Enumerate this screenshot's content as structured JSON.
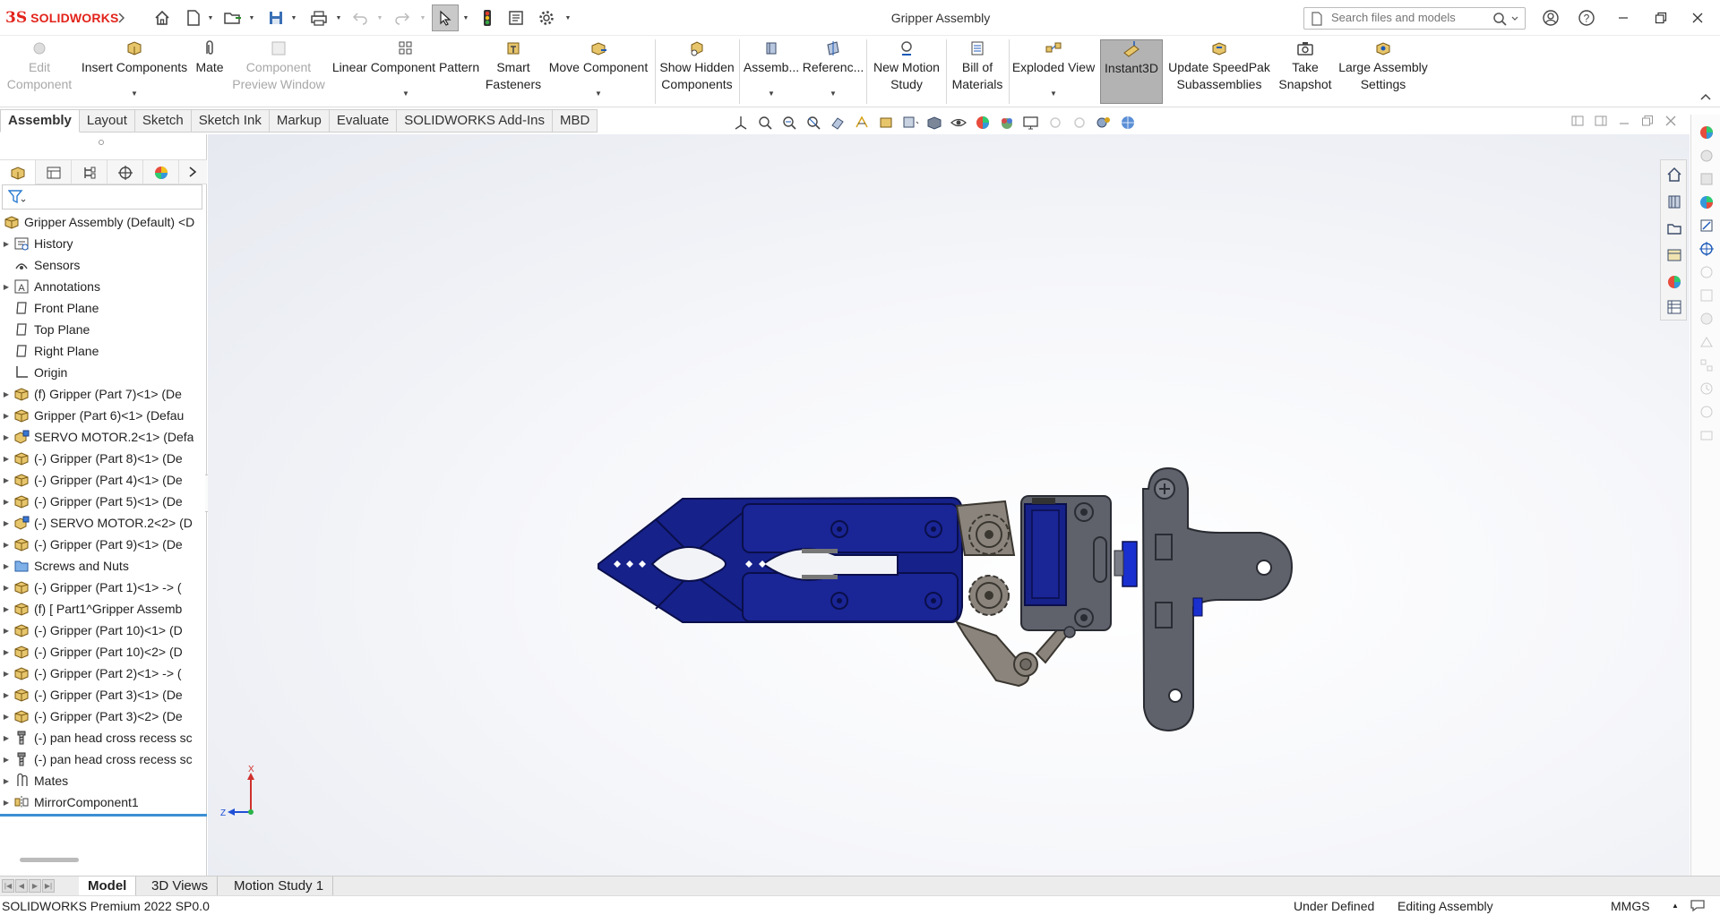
{
  "app": {
    "logo_text": "SOLIDWORKS",
    "document_title": "Gripper Assembly",
    "search_placeholder": "Search files and models"
  },
  "ribbon": {
    "buttons": [
      {
        "label_1": "Edit",
        "label_2": "Component",
        "enabled": false
      },
      {
        "label_1": "Insert Components",
        "label_2": "",
        "enabled": true
      },
      {
        "label_1": "Mate",
        "label_2": "",
        "enabled": true
      },
      {
        "label_1": "Component",
        "label_2": "Preview Window",
        "enabled": false
      },
      {
        "label_1": "Linear Component Pattern",
        "label_2": "",
        "enabled": true
      },
      {
        "label_1": "Smart",
        "label_2": "Fasteners",
        "enabled": true
      },
      {
        "label_1": "Move Component",
        "label_2": "",
        "enabled": true
      },
      {
        "label_1": "Show Hidden",
        "label_2": "Components",
        "enabled": true
      },
      {
        "label_1": "Assemb...",
        "label_2": "",
        "enabled": true
      },
      {
        "label_1": "Referenc...",
        "label_2": "",
        "enabled": true
      },
      {
        "label_1": "New Motion",
        "label_2": "Study",
        "enabled": true
      },
      {
        "label_1": "Bill of",
        "label_2": "Materials",
        "enabled": true
      },
      {
        "label_1": "Exploded View",
        "label_2": "",
        "enabled": true
      },
      {
        "label_1": "Instant3D",
        "label_2": "",
        "enabled": true,
        "active": true
      },
      {
        "label_1": "Update SpeedPak",
        "label_2": "Subassemblies",
        "enabled": true
      },
      {
        "label_1": "Take",
        "label_2": "Snapshot",
        "enabled": true
      },
      {
        "label_1": "Large Assembly",
        "label_2": "Settings",
        "enabled": true
      }
    ]
  },
  "command_tabs": [
    "Assembly",
    "Layout",
    "Sketch",
    "Sketch Ink",
    "Markup",
    "Evaluate",
    "SOLIDWORKS Add-Ins",
    "MBD"
  ],
  "active_command_tab": "Assembly",
  "feature_tree": {
    "root": "Gripper Assembly (Default) <D",
    "items": [
      {
        "label": "History",
        "icon": "history-icon",
        "expandable": true
      },
      {
        "label": "Sensors",
        "icon": "sensors-icon",
        "expandable": false
      },
      {
        "label": "Annotations",
        "icon": "annotations-icon",
        "expandable": true
      },
      {
        "label": "Front Plane",
        "icon": "plane-icon",
        "expandable": false
      },
      {
        "label": "Top Plane",
        "icon": "plane-icon",
        "expandable": false
      },
      {
        "label": "Right Plane",
        "icon": "plane-icon",
        "expandable": false
      },
      {
        "label": "Origin",
        "icon": "origin-icon",
        "expandable": false
      },
      {
        "label": "(f) Gripper (Part 7)<1> (De",
        "icon": "part-icon",
        "expandable": true
      },
      {
        "label": "Gripper (Part 6)<1> (Defau",
        "icon": "part-icon",
        "expandable": true
      },
      {
        "label": "SERVO MOTOR.2<1> (Defa",
        "icon": "assembly-icon",
        "expandable": true
      },
      {
        "label": "(-) Gripper (Part 8)<1> (De",
        "icon": "part-icon",
        "expandable": true
      },
      {
        "label": "(-) Gripper (Part 4)<1> (De",
        "icon": "part-icon",
        "expandable": true
      },
      {
        "label": "(-) Gripper (Part 5)<1> (De",
        "icon": "part-icon",
        "expandable": true
      },
      {
        "label": "(-) SERVO MOTOR.2<2> (D",
        "icon": "assembly-icon",
        "expandable": true
      },
      {
        "label": "(-) Gripper (Part 9)<1> (De",
        "icon": "part-icon",
        "expandable": true
      },
      {
        "label": "Screws and Nuts",
        "icon": "folder-icon",
        "expandable": true
      },
      {
        "label": "(-) Gripper (Part 1)<1> -> (",
        "icon": "part-icon",
        "expandable": true
      },
      {
        "label": "(f) [ Part1^Gripper Assemb",
        "icon": "part-icon",
        "expandable": true
      },
      {
        "label": "(-) Gripper (Part 10)<1> (D",
        "icon": "part-icon",
        "expandable": true
      },
      {
        "label": "(-) Gripper (Part 10)<2> (D",
        "icon": "part-icon",
        "expandable": true
      },
      {
        "label": "(-) Gripper (Part 2)<1> -> (",
        "icon": "part-icon",
        "expandable": true
      },
      {
        "label": "(-) Gripper (Part 3)<1> (De",
        "icon": "part-icon",
        "expandable": true
      },
      {
        "label": "(-) Gripper (Part 3)<2> (De",
        "icon": "part-icon",
        "expandable": true
      },
      {
        "label": "(-) pan head cross recess sc",
        "icon": "screw-icon",
        "expandable": true
      },
      {
        "label": "(-) pan head cross recess sc",
        "icon": "screw-icon",
        "expandable": true
      },
      {
        "label": "Mates",
        "icon": "mates-icon",
        "expandable": true
      },
      {
        "label": "MirrorComponent1",
        "icon": "mirror-component-icon",
        "expandable": true
      }
    ]
  },
  "triad": {
    "x_label": "X",
    "z_label": "Z"
  },
  "bottom_tabs": [
    "Model",
    "3D Views",
    "Motion Study 1"
  ],
  "active_bottom_tab": "Model",
  "status": {
    "product": "SOLIDWORKS Premium 2022 SP0.0",
    "definition": "Under Defined",
    "mode": "Editing Assembly",
    "units": "MMGS"
  },
  "colors": {
    "brand_red": "#e2231a",
    "part_blue": "#16218a",
    "part_gray": "#5f616b",
    "gear_gray": "#8a847c",
    "selection_blue": "#3b8fd3"
  }
}
